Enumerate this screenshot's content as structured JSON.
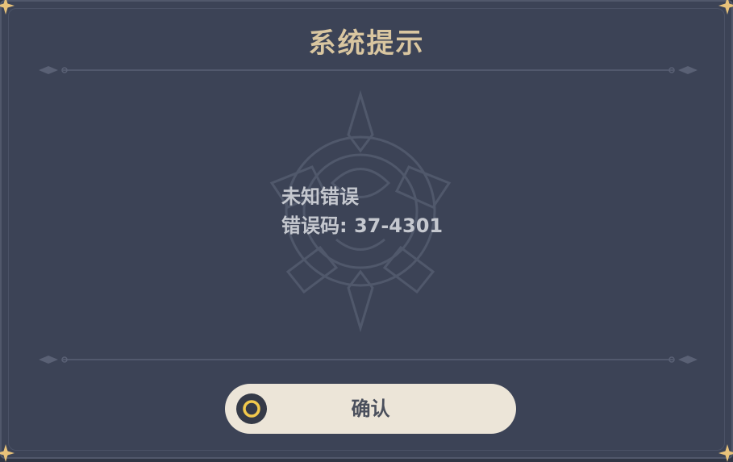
{
  "dialog": {
    "title": "系统提示",
    "message": {
      "line1": "未知错误",
      "line2": "错误码: 37-4301"
    },
    "confirm_button": {
      "label": "确认",
      "icon": "controller-a-button-icon"
    }
  },
  "colors": {
    "panel_background": "#3c4356",
    "title_text": "#d9c6a0",
    "message_text": "#c5c8cf",
    "button_background": "#ece5d8",
    "button_text": "#4a4f5c",
    "button_icon_ring": "#f2c94c",
    "corner_star": "#e8c27a"
  }
}
